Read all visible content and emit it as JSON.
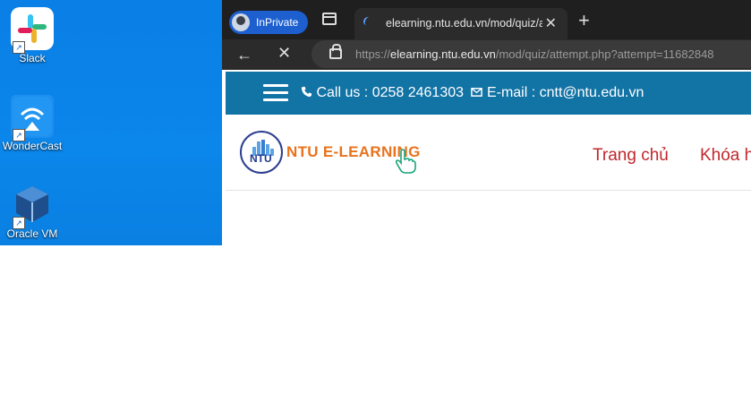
{
  "desktop": {
    "icons": [
      {
        "label": "Slack",
        "icon": "slack-icon"
      },
      {
        "label": "WonderCast",
        "icon": "wondercast-icon"
      },
      {
        "label": "Oracle VM",
        "icon": "virtualbox-icon"
      }
    ]
  },
  "browser": {
    "profile_label": "InPrivate",
    "tab_title": "elearning.ntu.edu.vn/mod/quiz/a",
    "url_host": "elearning.ntu.edu.vn",
    "url_path": "/mod/quiz/attempt.php?attempt=11682848"
  },
  "page": {
    "contact": "Call us : 0258 2461303",
    "email": "E-mail : cntt@ntu.edu.vn",
    "logo_abbr": "NTU",
    "logo_text": "NTU E-LEARNING",
    "nav": [
      "Trang chủ",
      "Khóa h"
    ]
  },
  "colors": {
    "desktop_bg": "#0a84e6",
    "topbar_bg": "#1273a5",
    "nav_text": "#c1272d",
    "logo_orange": "#e8731c"
  }
}
